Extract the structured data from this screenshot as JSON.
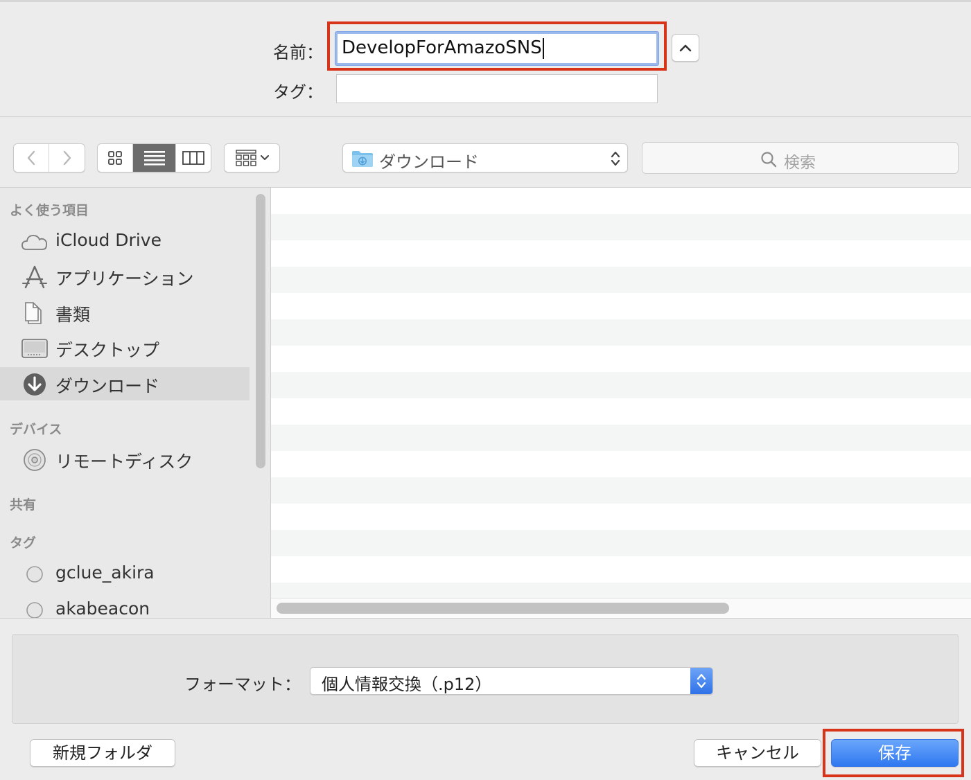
{
  "name_field": {
    "label": "名前：",
    "value": "DevelopForAmazoSNS"
  },
  "tag_field": {
    "label": "タグ：",
    "value": ""
  },
  "toolbar": {
    "location": "ダウンロード",
    "search_placeholder": "検索"
  },
  "sidebar": {
    "favorites_header": "よく使う項目",
    "favorites": [
      {
        "label": "iCloud Drive",
        "icon": "cloud-icon"
      },
      {
        "label": "アプリケーション",
        "icon": "applications-icon"
      },
      {
        "label": "書類",
        "icon": "documents-icon"
      },
      {
        "label": "デスクトップ",
        "icon": "desktop-icon"
      },
      {
        "label": "ダウンロード",
        "icon": "downloads-icon",
        "selected": true
      }
    ],
    "devices_header": "デバイス",
    "devices": [
      {
        "label": "リモートディスク",
        "icon": "disc-icon"
      }
    ],
    "shared_header": "共有",
    "tags_header": "タグ",
    "tags": [
      {
        "label": "gclue_akira"
      },
      {
        "label": "akabeacon"
      }
    ]
  },
  "format": {
    "label": "フォーマット：",
    "value": "個人情報交換（.p12）"
  },
  "buttons": {
    "new_folder": "新規フォルダ",
    "cancel": "キャンセル",
    "save": "保存"
  },
  "colors": {
    "highlight": "#d7341a",
    "primary_button": "#2f78f0",
    "focus_ring": "#9cb9ec"
  }
}
